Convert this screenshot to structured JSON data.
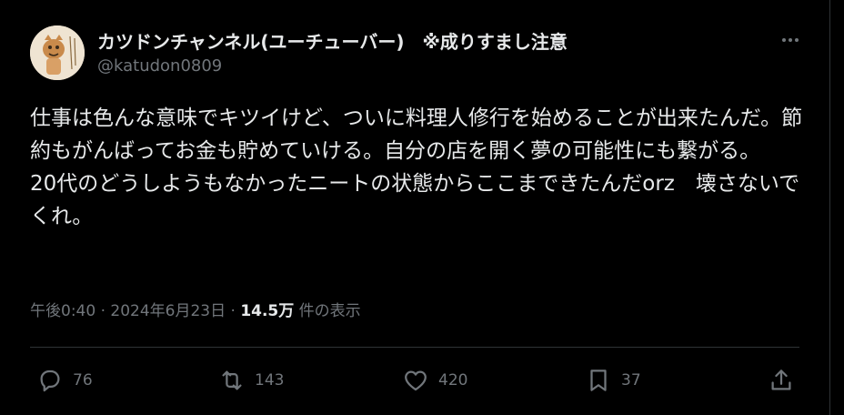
{
  "tweet": {
    "display_name": "カツドンチャンネル(ユーチューバー)　※成りすまし注意",
    "handle": "@katudon0809",
    "text": "仕事は色んな意味でキツイけど、ついに料理人修行を始めることが出来たんだ。節約もがんばってお金も貯めていける。自分の店を開く夢の可能性にも繋がる。\n20代のどうしようもなかったニートの状態からここまできたんだorz　壊さないでくれ。",
    "timestamp": "午後0:40 · 2024年6月23日 · ",
    "views": "14.5万",
    "views_suffix": " 件の表示"
  },
  "actions": {
    "replies": "76",
    "retweets": "143",
    "likes": "420",
    "bookmarks": "37"
  },
  "icons": {
    "more": "more-icon",
    "reply": "reply-icon",
    "retweet": "retweet-icon",
    "like": "heart-icon",
    "bookmark": "bookmark-icon",
    "share": "share-icon"
  },
  "colors": {
    "background": "#000000",
    "text": "#e7e9ea",
    "muted": "#71767b",
    "border": "#2f3336"
  }
}
